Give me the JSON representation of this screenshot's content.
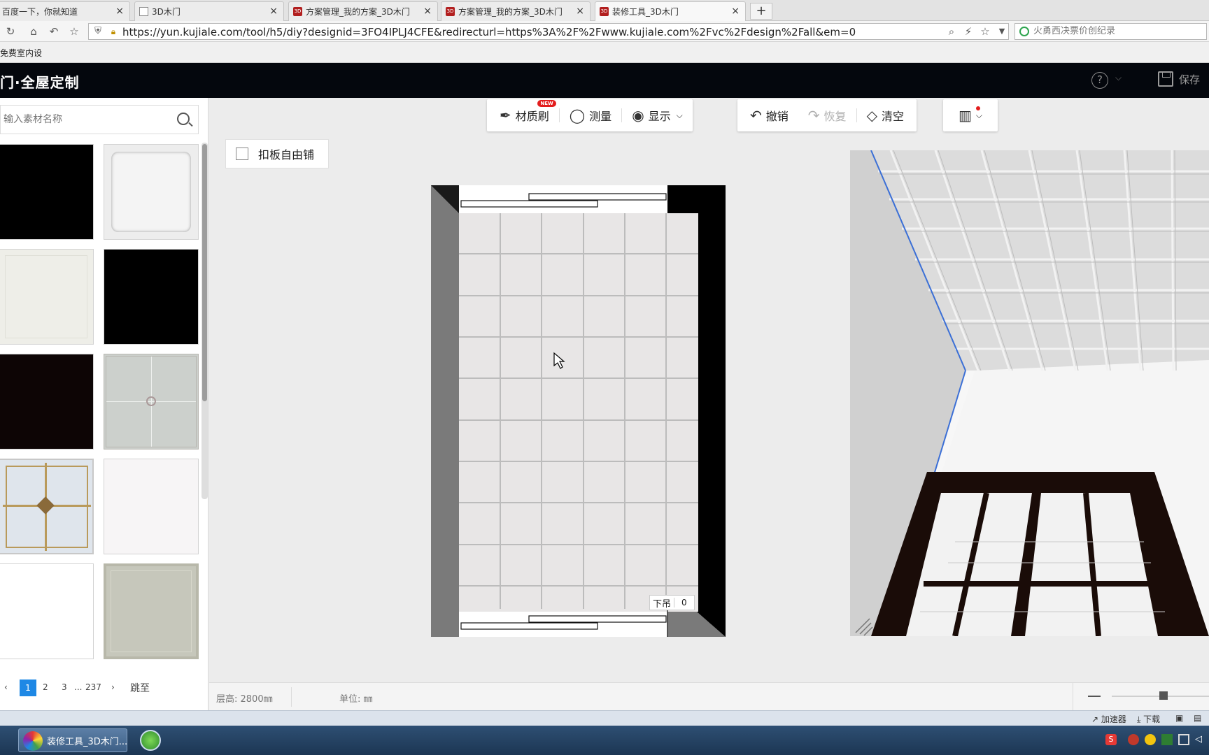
{
  "browser": {
    "tabs": [
      {
        "label": "百度一下，你就知道",
        "icon": "none"
      },
      {
        "label": "3D木门",
        "icon": "doc"
      },
      {
        "label": "方案管理_我的方案_3D木门",
        "icon": "red"
      },
      {
        "label": "方案管理_我的方案_3D木门",
        "icon": "red"
      },
      {
        "label": "装修工具_3D木门",
        "icon": "red"
      }
    ],
    "close_glyph": "×",
    "newtab_glyph": "+",
    "url": "https://yun.kujiale.com/tool/h5/diy?designid=3FO4IPLJ4CFE&redirecturl=https%3A%2F%2Fwww.kujiale.com%2Fvc%2Fdesign%2Fall&em=0",
    "search_text": "火勇西决票价创纪录",
    "bookmark": "免费室内设"
  },
  "app": {
    "brand": "门·全屋定制",
    "help_glyph": "?",
    "save_label": "保存"
  },
  "left_panel": {
    "search_placeholder": "输入素材名称",
    "pager": {
      "p1": "1",
      "p2": "2",
      "p3": "3",
      "ellipsis": "...",
      "last": "237",
      "prev": "‹",
      "next": "›",
      "jump": "跳至"
    }
  },
  "toolbar": {
    "brush": "材质刷",
    "new_badge": "NEW",
    "measure": "测量",
    "display": "显示",
    "undo": "撤销",
    "redo": "恢复",
    "clear": "清空"
  },
  "canvas": {
    "free_lay": "扣板自由铺",
    "drop_label": "下吊",
    "drop_value": "0"
  },
  "bottom": {
    "height_label": "层高: 2800㎜",
    "unit_label": "单位: ㎜"
  },
  "statusbar": {
    "accel": "加速器",
    "download": "下载"
  },
  "taskbar": {
    "app_label": "装修工具_3D木门..."
  },
  "colors": {
    "header_bg": "#04070d",
    "accent": "#1e88e5",
    "badge": "#e31d1d"
  }
}
